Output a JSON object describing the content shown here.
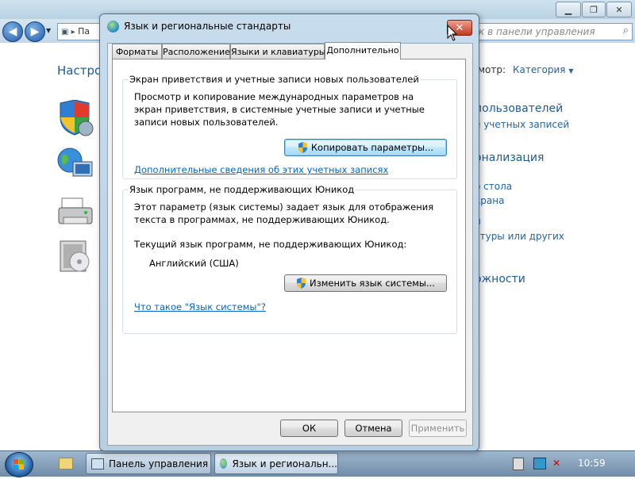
{
  "background_window": {
    "search_placeholder": "к в панели управления",
    "path_label": "Па",
    "heading_partial": "Настро",
    "view_by_label": "мотр:",
    "view_by_value": "Категория",
    "right_items": [
      {
        "text": "пользователей",
        "kind": "head"
      },
      {
        "text": "е учетных записей",
        "kind": "link"
      },
      {
        "text": "онализация",
        "kind": "head"
      },
      {
        "text": "о стола",
        "kind": "link"
      },
      {
        "text": "крана",
        "kind": "link"
      },
      {
        "text": "н",
        "kind": "link"
      },
      {
        "text": "стуры или других",
        "kind": "link"
      },
      {
        "text": "ожности",
        "kind": "head"
      }
    ]
  },
  "dialog": {
    "title": "Язык и региональные стандарты",
    "tabs": [
      {
        "label": "Форматы",
        "active": false
      },
      {
        "label": "Расположение",
        "active": false
      },
      {
        "label": "Языки и клавиатуры",
        "active": false
      },
      {
        "label": "Дополнительно",
        "active": true
      }
    ],
    "group1": {
      "title": "Экран приветствия и учетные записи новых пользователей",
      "description": "Просмотр и копирование международных параметров на экран приветствия, в системные учетные записи и учетные записи новых пользователей.",
      "button": "Копировать параметры...",
      "link": "Дополнительные сведения об этих учетных записях"
    },
    "group2": {
      "title": "Язык программ, не поддерживающих Юникод",
      "description": "Этот параметр (язык системы) задает язык для отображения текста в программах, не поддерживающих Юникод.",
      "current_label": "Текущий язык программ, не поддерживающих Юникод:",
      "current_value": "Английский (США)",
      "button": "Изменить язык системы...",
      "link": "Что такое \"Язык системы\"?"
    },
    "buttons": {
      "ok": "ОК",
      "cancel": "Отмена",
      "apply": "Применить"
    }
  },
  "taskbar": {
    "items": [
      {
        "label": "Панель управления"
      },
      {
        "label": "Язык и региональн..."
      }
    ],
    "clock": "10:59"
  },
  "colors": {
    "link": "#0066cc",
    "heading": "#1e5a96",
    "close_button": "#c23a20"
  }
}
